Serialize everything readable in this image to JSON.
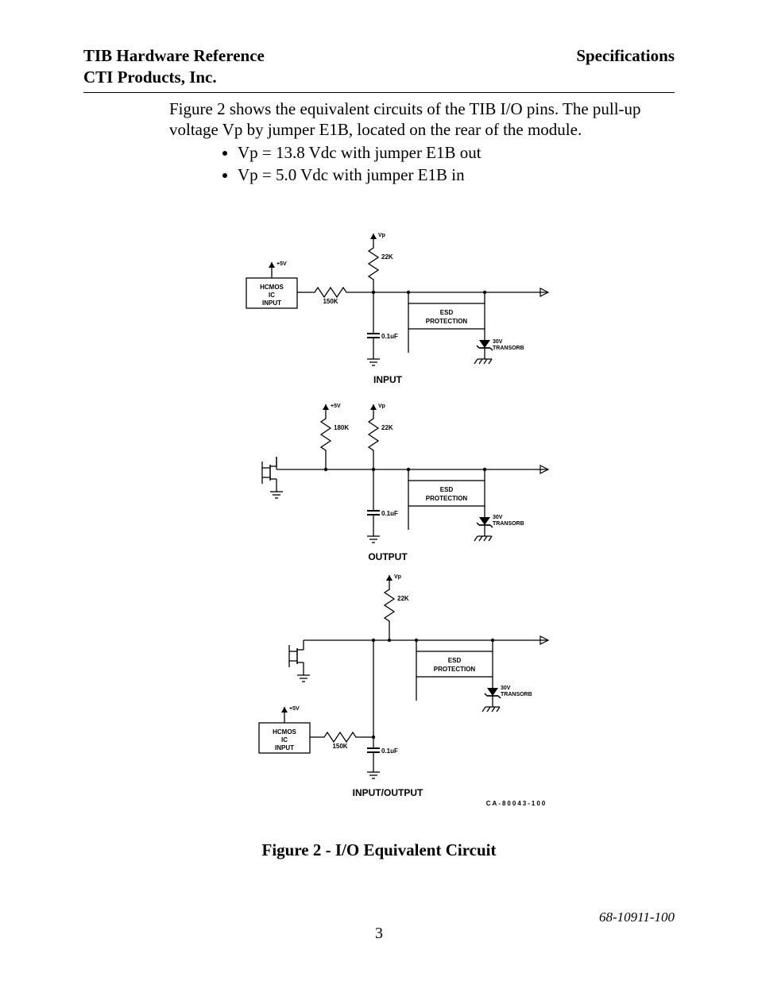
{
  "header": {
    "left_line1": "TIB Hardware Reference",
    "left_line2": "CTI Products, Inc.",
    "right": "Specifications"
  },
  "intro": {
    "p1": "Figure 2 shows the equivalent circuits of the TIB I/O pins.  The pull-up voltage Vp by jumper E1B, located on the rear of the module.",
    "b1": "Vp = 13.8 Vdc with jumper E1B out",
    "b2": "Vp = 5.0 Vdc with jumper E1B in"
  },
  "figure": {
    "caption": "Figure 2 - I/O Equivalent Circuit",
    "drawing_id": "CA-80043-100",
    "labels": {
      "hcmos1": "HCMOS",
      "hcmos2": "IC",
      "hcmos3": "INPUT",
      "esd1": "ESD",
      "esd2": "PROTECTION",
      "vp": "Vp",
      "p5v": "+5V",
      "r22k": "22K",
      "r150k": "150K",
      "r180k": "180K",
      "c01": "0.1uF",
      "tvs1": "30V",
      "tvs2": "TRANSORB",
      "cap_input": "INPUT",
      "cap_output": "OUTPUT",
      "cap_io": "INPUT/OUTPUT"
    }
  },
  "footer": {
    "docnum": "68-10911-100",
    "page": "3"
  }
}
